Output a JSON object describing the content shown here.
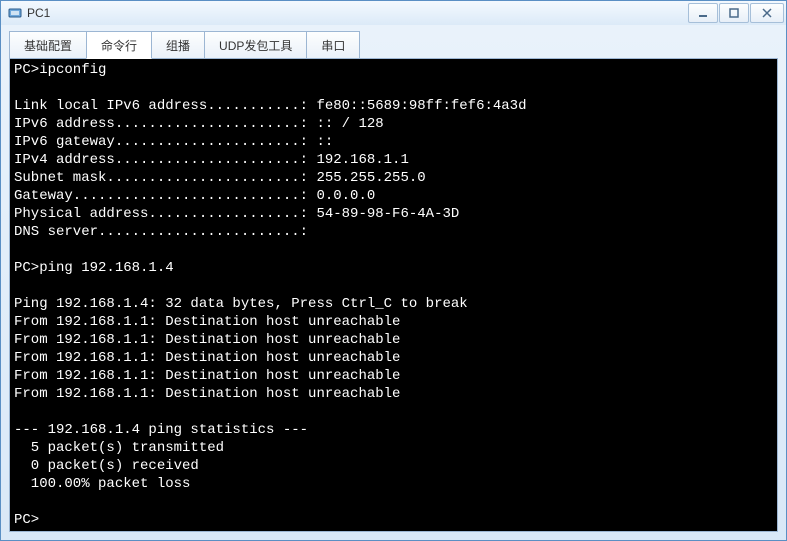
{
  "window": {
    "title": "PC1"
  },
  "tabs": {
    "t0": "基础配置",
    "t1": "命令行",
    "t2": "组播",
    "t3": "UDP发包工具",
    "t4": "串口"
  },
  "terminal": {
    "line01": "PC>ipconfig",
    "line02": "",
    "line03": "Link local IPv6 address...........: fe80::5689:98ff:fef6:4a3d",
    "line04": "IPv6 address......................: :: / 128",
    "line05": "IPv6 gateway......................: ::",
    "line06": "IPv4 address......................: 192.168.1.1",
    "line07": "Subnet mask.......................: 255.255.255.0",
    "line08": "Gateway...........................: 0.0.0.0",
    "line09": "Physical address..................: 54-89-98-F6-4A-3D",
    "line10": "DNS server........................:",
    "line11": "",
    "line12": "PC>ping 192.168.1.4",
    "line13": "",
    "line14": "Ping 192.168.1.4: 32 data bytes, Press Ctrl_C to break",
    "line15": "From 192.168.1.1: Destination host unreachable",
    "line16": "From 192.168.1.1: Destination host unreachable",
    "line17": "From 192.168.1.1: Destination host unreachable",
    "line18": "From 192.168.1.1: Destination host unreachable",
    "line19": "From 192.168.1.1: Destination host unreachable",
    "line20": "",
    "line21": "--- 192.168.1.4 ping statistics ---",
    "line22": "  5 packet(s) transmitted",
    "line23": "  0 packet(s) received",
    "line24": "  100.00% packet loss",
    "line25": "",
    "line26": "PC>"
  }
}
